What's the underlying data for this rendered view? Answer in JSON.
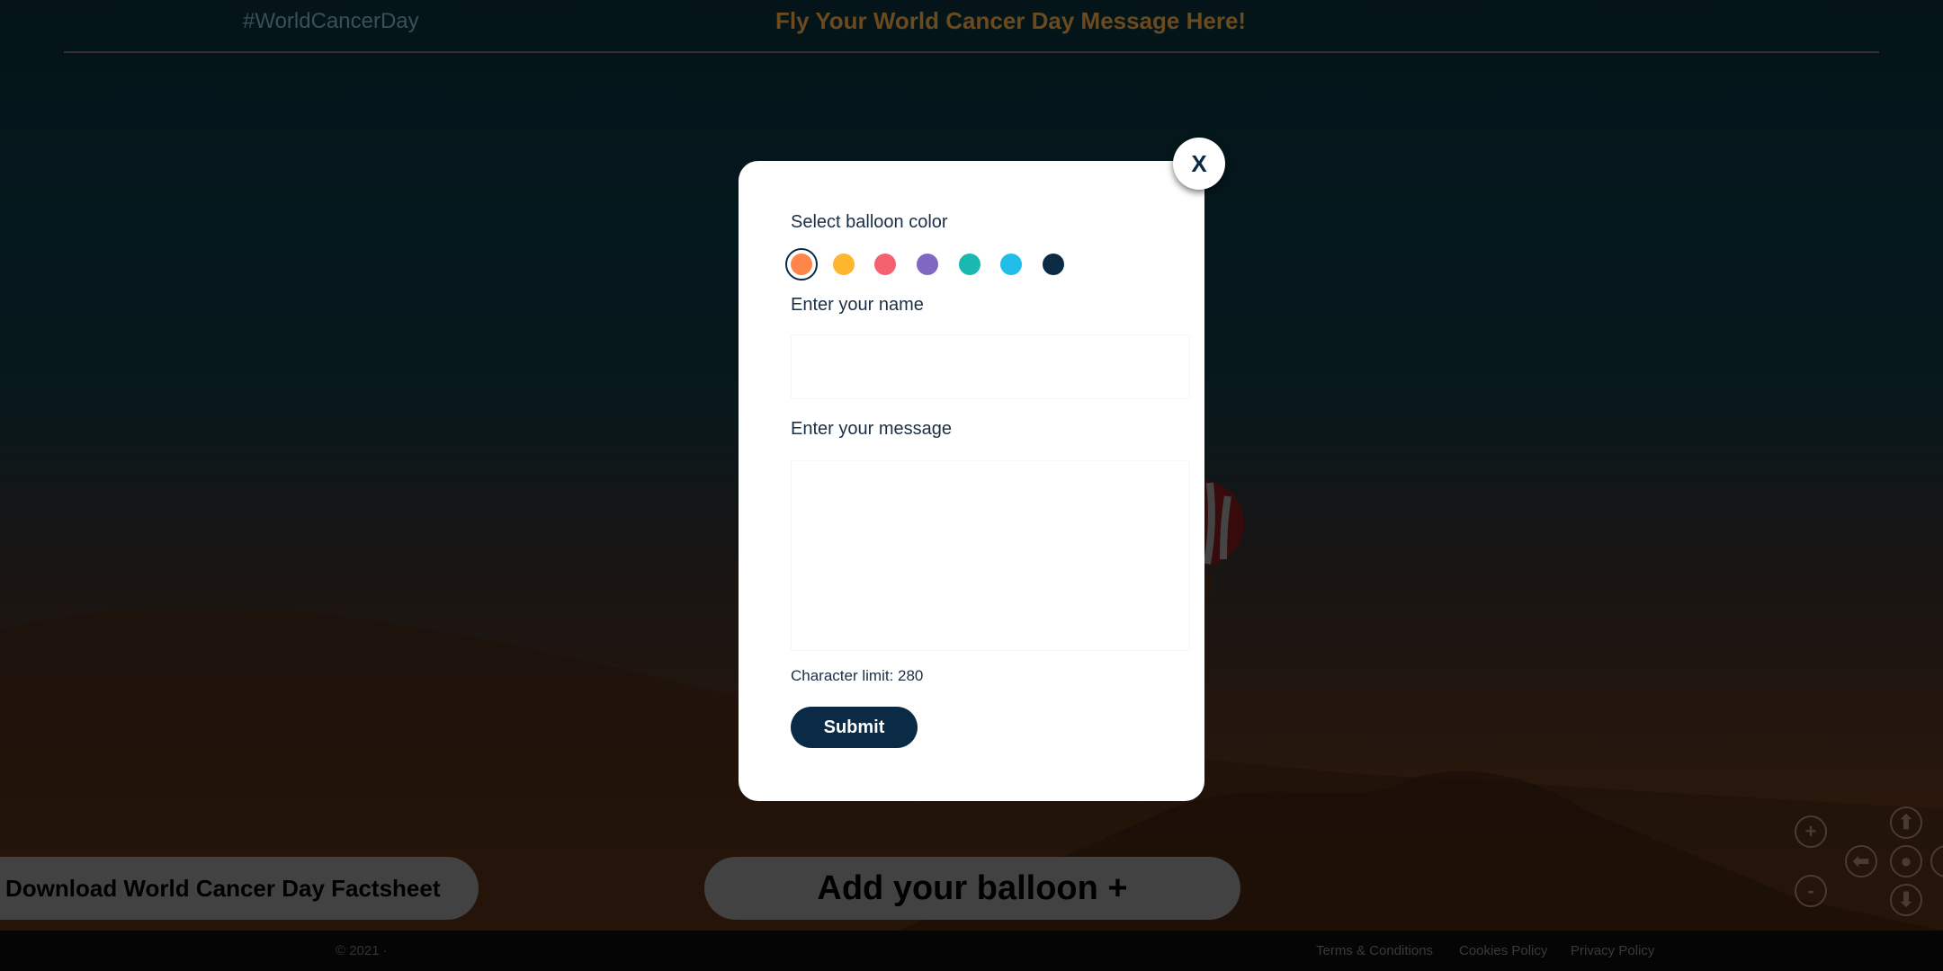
{
  "header": {
    "hashtag": "#WorldCancerDay",
    "title": "Fly Your World Cancer Day Message Here!"
  },
  "bottom": {
    "factsheet_label": "Download World Cancer Day Factsheet",
    "add_balloon_label": "Add your balloon +"
  },
  "controls": {
    "zoom_in": "+",
    "zoom_out": "-"
  },
  "footer": {
    "copyright": "© 2021 ·",
    "links": [
      "Terms & Conditions",
      "Cookies Policy",
      "Privacy Policy"
    ]
  },
  "modal": {
    "close_label": "X",
    "color_label": "Select balloon color",
    "colors": [
      "#ff8548",
      "#ffb52e",
      "#f4626f",
      "#7f68c2",
      "#1bb8b0",
      "#1fbde8",
      "#0b2a45"
    ],
    "selected_color_index": 0,
    "name_label": "Enter your name",
    "name_value": "",
    "message_label": "Enter your message",
    "message_value": "",
    "char_limit": "Character limit: 280",
    "submit_label": "Submit"
  }
}
